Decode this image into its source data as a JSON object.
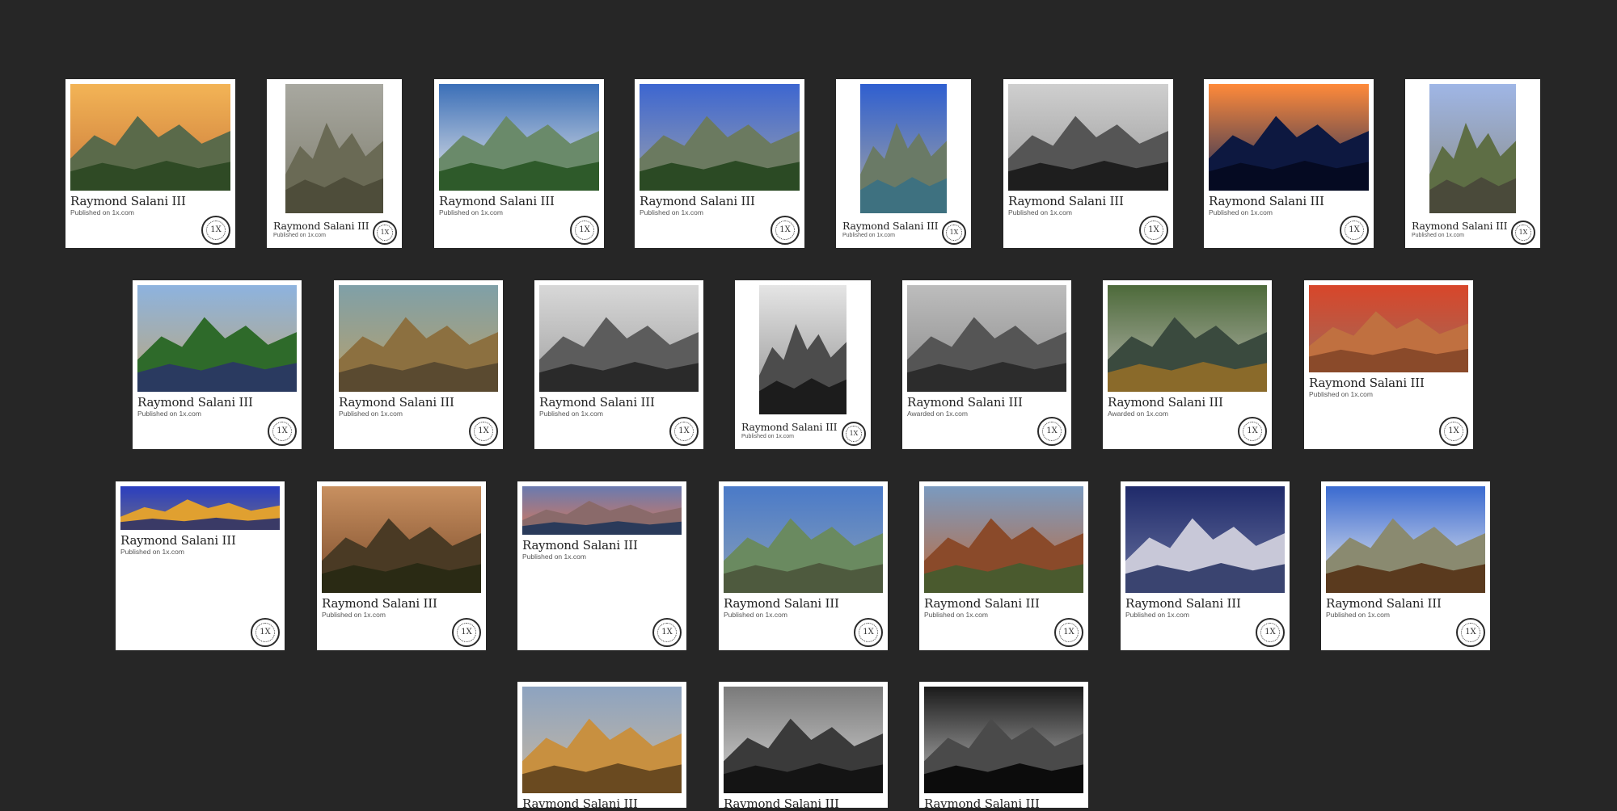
{
  "palettes": {
    "sunset": [
      "#f3b456",
      "#c9793a",
      "#5a6a4a",
      "#2f4a25"
    ],
    "waterfall": [
      "#a8a8a0",
      "#7d7c6c",
      "#6a6a55",
      "#4e4d3a"
    ],
    "clouds_spring": [
      "#3b6fb8",
      "#e8e8e8",
      "#6a8a6a",
      "#2e5a2a"
    ],
    "peaks_blue": [
      "#3d66d0",
      "#9aa0ad",
      "#6b7a60",
      "#2b4a24"
    ],
    "lake_peaks": [
      "#2f5fd0",
      "#aaa8a0",
      "#6a7a66",
      "#3e7180"
    ],
    "bw_valley": [
      "#cfcfcf",
      "#9a9a9a",
      "#555555",
      "#1e1e1e"
    ],
    "night_lake": [
      "#ff8a3a",
      "#1d2c5a",
      "#0d1840",
      "#050a22"
    ],
    "trail_peak": [
      "#9fb6e6",
      "#8a8a80",
      "#5e6e45",
      "#4a4a3a"
    ],
    "reflection": [
      "#8db3df",
      "#bca77a",
      "#2e6a2a",
      "#2a3a60"
    ],
    "canyon_falls": [
      "#7fa0a8",
      "#b9a06a",
      "#8c7040",
      "#5a4a30"
    ],
    "bw_peaks": [
      "#d8d8d8",
      "#a0a0a0",
      "#5c5c5c",
      "#2a2a2a"
    ],
    "bw_falls": [
      "#e5e5e5",
      "#8e8e8e",
      "#4c4c4c",
      "#1c1c1c"
    ],
    "bw_plain": [
      "#bdbdbd",
      "#8a8a8a",
      "#555555",
      "#2c2c2c"
    ],
    "green_falls": [
      "#4d6a3a",
      "#b8b8b0",
      "#3a4a3e",
      "#8a6a2a"
    ],
    "bryce": [
      "#d8462a",
      "#a06a5a",
      "#c07040",
      "#8a4a2a"
    ],
    "autumn_lake": [
      "#2a3ec0",
      "#6a6a8a",
      "#e0a030",
      "#3a3a66"
    ],
    "glow_valley": [
      "#c89060",
      "#7a4a2a",
      "#4a3a24",
      "#2a2a14"
    ],
    "alpenglow": [
      "#6a7ab0",
      "#d97858",
      "#8a6a6a",
      "#2a3a5a"
    ],
    "ridge": [
      "#4a7ac8",
      "#8aa0b8",
      "#6a8a60",
      "#4e5a3e"
    ],
    "zion": [
      "#7a9ac0",
      "#c06a3a",
      "#8a4a2a",
      "#4a5a2e"
    ],
    "moon_peak": [
      "#1f2a6a",
      "#6a74a0",
      "#c8c8d8",
      "#3a4470"
    ],
    "blue_sky_peak": [
      "#3a6ad0",
      "#f0f0f0",
      "#8a8a70",
      "#5a3a1e"
    ],
    "moon_grass": [
      "#8da3c0",
      "#c8b8a0",
      "#c89040",
      "#6a4a20"
    ],
    "bw_mist": [
      "#7a7a7a",
      "#d6d6d6",
      "#3a3a3a",
      "#141414"
    ],
    "bw_night": [
      "#1a1a1a",
      "#bfbfbf",
      "#4a4a4a",
      "#0c0c0c"
    ]
  },
  "cards": [
    {
      "name": "Raymond Salani III",
      "sub": "Published on 1x.com",
      "seal": "1X"
    },
    {
      "name": "Raymond Salani III",
      "sub": "Published on 1x.com",
      "seal": "1X"
    },
    {
      "name": "Raymond Salani III",
      "sub": "Published on 1x.com",
      "seal": "1X"
    },
    {
      "name": "Raymond Salani III",
      "sub": "Published on 1x.com",
      "seal": "1X"
    },
    {
      "name": "Raymond Salani III",
      "sub": "Published on 1x.com",
      "seal": "1X"
    },
    {
      "name": "Raymond Salani III",
      "sub": "Published on 1x.com",
      "seal": "1X"
    },
    {
      "name": "Raymond Salani III",
      "sub": "Published on 1x.com",
      "seal": "1X"
    },
    {
      "name": "Raymond Salani III",
      "sub": "Published on 1x.com",
      "seal": "1X"
    },
    {
      "name": "Raymond Salani III",
      "sub": "Published on 1x.com",
      "seal": "1X"
    },
    {
      "name": "Raymond Salani III",
      "sub": "Published on 1x.com",
      "seal": "1X"
    },
    {
      "name": "Raymond Salani III",
      "sub": "Published on 1x.com",
      "seal": "1X"
    },
    {
      "name": "Raymond Salani III",
      "sub": "Published on 1x.com",
      "seal": "1X"
    },
    {
      "name": "Raymond Salani III",
      "sub": "Awarded on 1x.com",
      "seal": "1X"
    },
    {
      "name": "Raymond Salani III",
      "sub": "Awarded on 1x.com",
      "seal": "1X"
    },
    {
      "name": "Raymond Salani III",
      "sub": "Published on 1x.com",
      "seal": "1X"
    },
    {
      "name": "Raymond Salani III",
      "sub": "Published on 1x.com",
      "seal": "1X"
    },
    {
      "name": "Raymond Salani III",
      "sub": "Published on 1x.com",
      "seal": "1X"
    },
    {
      "name": "Raymond Salani III",
      "sub": "Published on 1x.com",
      "seal": "1X"
    },
    {
      "name": "Raymond Salani III",
      "sub": "Published on 1x.com",
      "seal": "1X"
    },
    {
      "name": "Raymond Salani III",
      "sub": "Published on 1x.com",
      "seal": "1X"
    },
    {
      "name": "Raymond Salani III",
      "sub": "Published on 1x.com",
      "seal": "1X"
    },
    {
      "name": "Raymond Salani III",
      "sub": "Published on 1x.com",
      "seal": "1X"
    },
    {
      "name": "Raymond Salani III"
    },
    {
      "name": "Raymond Salani III"
    },
    {
      "name": "Raymond Salani III"
    }
  ]
}
